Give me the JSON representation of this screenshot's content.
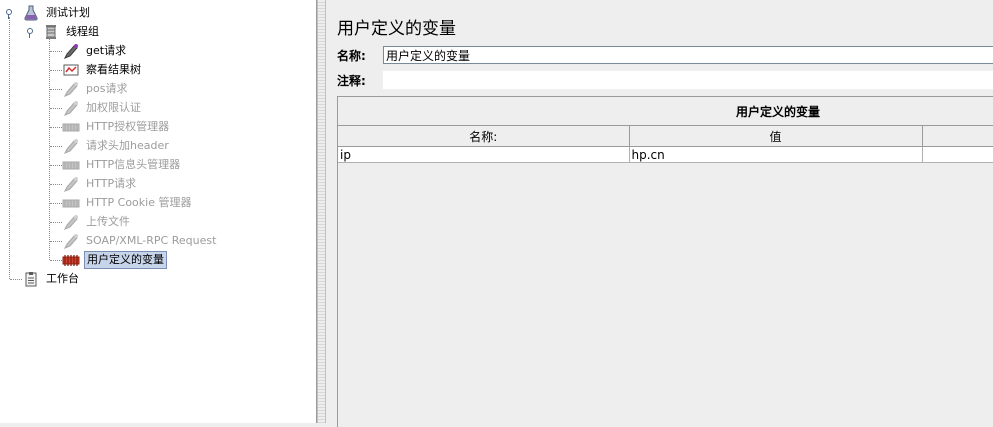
{
  "tree": {
    "root_label": "测试计划",
    "thread_group_label": "线程组",
    "children": [
      {
        "label": "get请求",
        "icon": "sampler-pipette-icon",
        "enabled": true
      },
      {
        "label": "察看结果树",
        "icon": "results-tree-icon",
        "enabled": true
      },
      {
        "label": "pos请求",
        "icon": "sampler-pipette-icon",
        "enabled": false
      },
      {
        "label": "加权限认证",
        "icon": "sampler-pipette-icon",
        "enabled": false
      },
      {
        "label": "HTTP授权管理器",
        "icon": "config-element-icon",
        "enabled": false
      },
      {
        "label": "请求头加header",
        "icon": "sampler-pipette-icon",
        "enabled": false
      },
      {
        "label": "HTTP信息头管理器",
        "icon": "config-element-icon",
        "enabled": false
      },
      {
        "label": "HTTP请求",
        "icon": "sampler-pipette-icon",
        "enabled": false
      },
      {
        "label": "HTTP Cookie 管理器",
        "icon": "config-element-icon",
        "enabled": false
      },
      {
        "label": "上传文件",
        "icon": "sampler-pipette-icon",
        "enabled": false
      },
      {
        "label": "SOAP/XML-RPC Request",
        "icon": "sampler-pipette-icon",
        "enabled": false
      },
      {
        "label": "用户定义的变量",
        "icon": "user-variables-icon",
        "enabled": true,
        "selected": true
      }
    ],
    "workbench_label": "工作台"
  },
  "panel": {
    "title": "用户定义的变量",
    "name_label": "名称:",
    "name_value": "用户定义的变量",
    "comment_label": "注释:",
    "comment_value": "",
    "table_title": "用户定义的变量",
    "columns": [
      "名称:",
      "值",
      ""
    ],
    "rows": [
      {
        "name": "ip",
        "value": "hp.cn",
        "description": ""
      }
    ]
  },
  "colors": {
    "selection": "#c7d5ea",
    "disabled_text": "#9c9c9c"
  }
}
